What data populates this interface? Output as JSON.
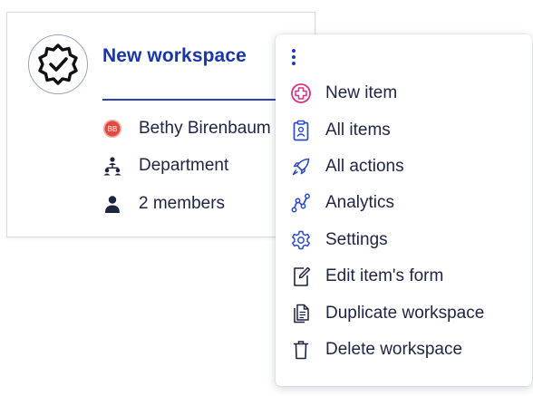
{
  "card": {
    "title": "New workspace",
    "owner": "Bethy Birenbaum",
    "owner_initials": "BB",
    "department": "Department",
    "members": "2 members"
  },
  "menu": {
    "items": [
      {
        "label": "New item",
        "icon": "plus-circle-icon"
      },
      {
        "label": "All items",
        "icon": "clipboard-icon"
      },
      {
        "label": "All actions",
        "icon": "rocket-icon"
      },
      {
        "label": "Analytics",
        "icon": "analytics-icon"
      },
      {
        "label": "Settings",
        "icon": "gear-icon"
      },
      {
        "label": "Edit item's form",
        "icon": "edit-form-icon"
      },
      {
        "label": "Duplicate workspace",
        "icon": "duplicate-icon"
      },
      {
        "label": "Delete workspace",
        "icon": "trash-icon"
      }
    ]
  },
  "colors": {
    "title": "#1936a8",
    "menu_icon": "#2b4bc4",
    "new_item_icon": "#d63384",
    "initials_bg": "#e04a3f"
  }
}
